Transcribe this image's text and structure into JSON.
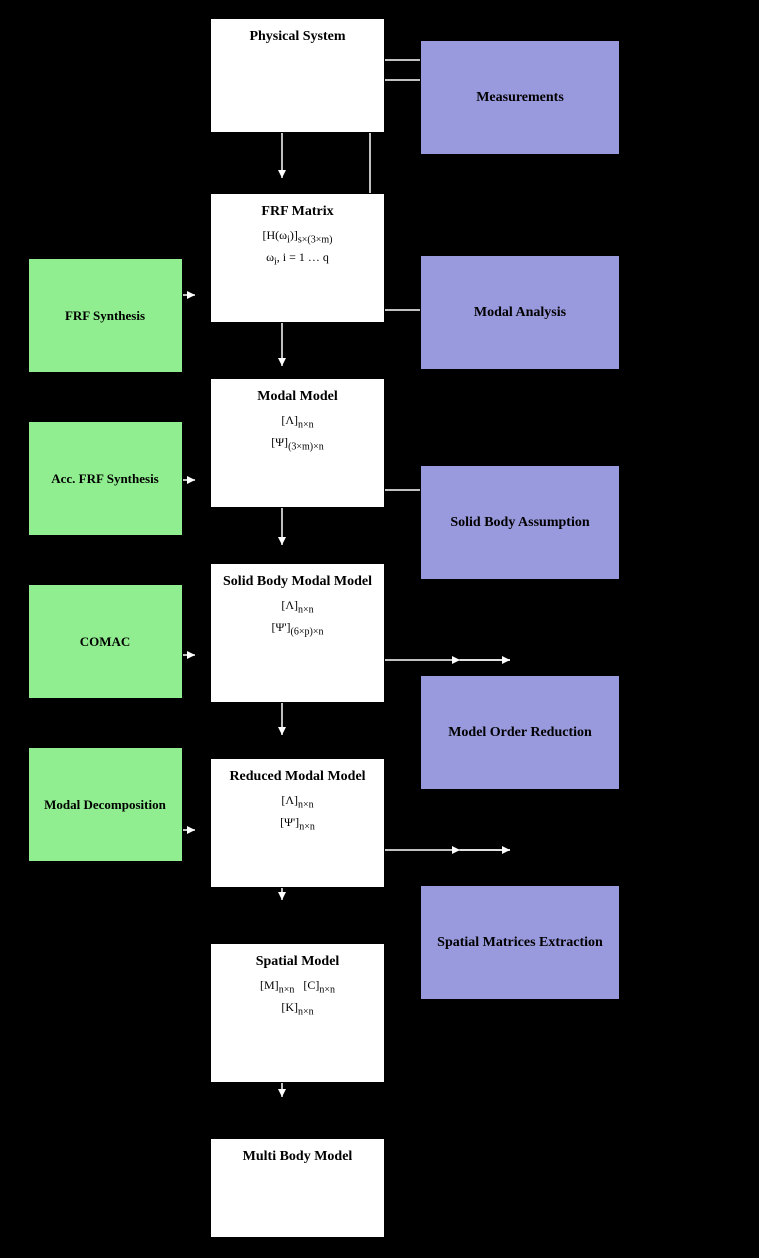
{
  "boxes": {
    "center": [
      {
        "id": "physical-system",
        "title": "Physical System",
        "content": ""
      },
      {
        "id": "frf-matrix",
        "title": "FRF Matrix",
        "content_lines": [
          "[H(ω_i)]_{s×(3×m)}",
          "ω_i, i = 1 … q"
        ]
      },
      {
        "id": "modal-model",
        "title": "Modal Model",
        "content_lines": [
          "[Λ]_{n×n}",
          "[Ψ]_{(3×m)×n}"
        ]
      },
      {
        "id": "solid-body-modal-model",
        "title": "Solid Body Modal Model",
        "content_lines": [
          "[Λ]_{n×n}",
          "[Ψ']_{(6×p)×n}"
        ]
      },
      {
        "id": "reduced-modal-model",
        "title": "Reduced Modal Model",
        "content_lines": [
          "[Λ]_{n×n}",
          "[Ψ']_{n×n}"
        ]
      },
      {
        "id": "spatial-model",
        "title": "Spatial Model",
        "content_lines": [
          "[M]_{n×n}   [C]_{n×n}",
          "[K]_{n×n}"
        ]
      },
      {
        "id": "multi-body-model",
        "title": "Multi Body Model",
        "content": ""
      }
    ],
    "left": [
      {
        "id": "frf-synthesis",
        "title": "FRF Synthesis"
      },
      {
        "id": "acc-frf-synthesis",
        "title": "Acc. FRF Synthesis"
      },
      {
        "id": "comac",
        "title": "COMAC"
      },
      {
        "id": "modal-decomposition",
        "title": "Modal Decomposition"
      }
    ],
    "right": [
      {
        "id": "measurements",
        "title": "Measurements"
      },
      {
        "id": "modal-analysis",
        "title": "Modal Analysis"
      },
      {
        "id": "solid-body-assumption",
        "title": "Solid Body Assumption"
      },
      {
        "id": "model-order-reduction",
        "title": "Model Order Reduction"
      },
      {
        "id": "spatial-matrices-extraction",
        "title": "Spatial Matrices Extraction"
      }
    ]
  }
}
